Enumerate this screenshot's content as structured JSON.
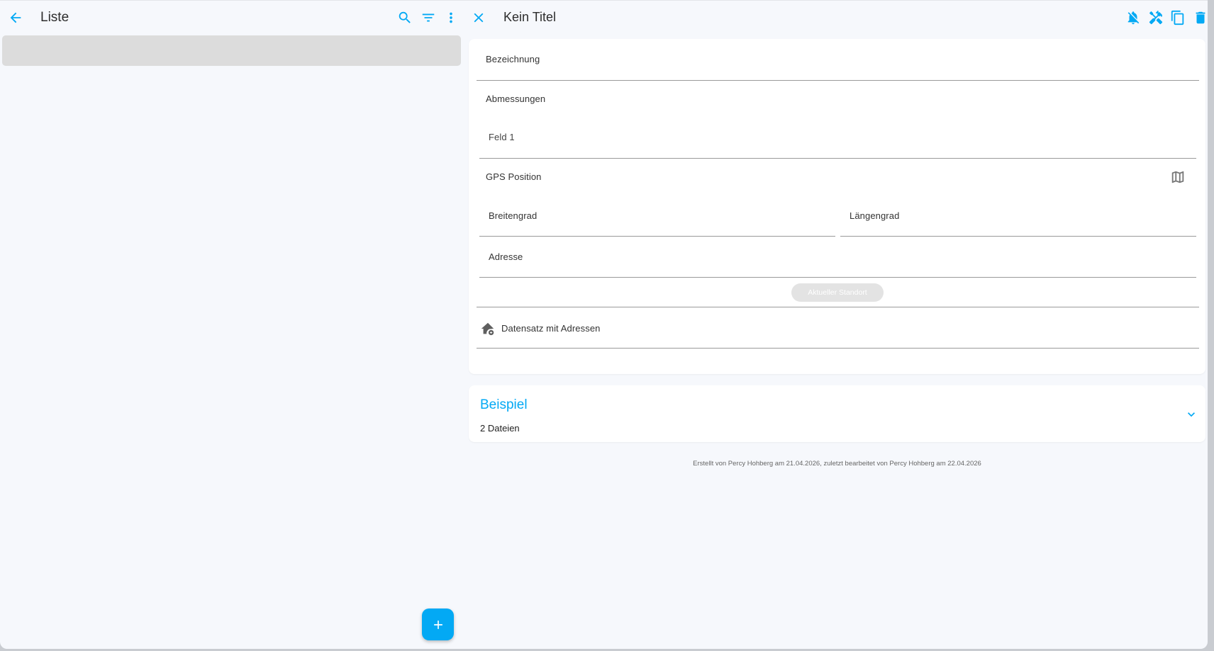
{
  "left": {
    "title": "Liste",
    "icons": [
      "arrow-left-icon",
      "search-icon",
      "filter-icon",
      "more-vert-icon"
    ],
    "fab_icon": "plus-icon"
  },
  "right": {
    "title": "Kein Titel",
    "icons": [
      "close-icon",
      "bell-off-icon",
      "tools-icon",
      "copy-icon",
      "delete-icon"
    ],
    "form": {
      "bezeichnung_label": "Bezeichnung",
      "abmessungen_label": "Abmessungen",
      "feld1_label": "Feld 1",
      "gps_label": "GPS Position",
      "breitengrad_label": "Breitengrad",
      "laengengrad_label": "Längengrad",
      "adresse_label": "Adresse",
      "standort_button": "Aktueller Standort",
      "datensatz_label": "Datensatz mit Adressen"
    },
    "attachments": {
      "title": "Beispiel",
      "count": "2 Dateien"
    },
    "footer": "Erstellt von Percy Hohberg am 21.04.2026, zuletzt bearbeitet von Percy Hohberg am 22.04.2026"
  },
  "colors": {
    "accent": "#03a9f4",
    "background": "#f6f8fc",
    "card": "#ffffff"
  }
}
